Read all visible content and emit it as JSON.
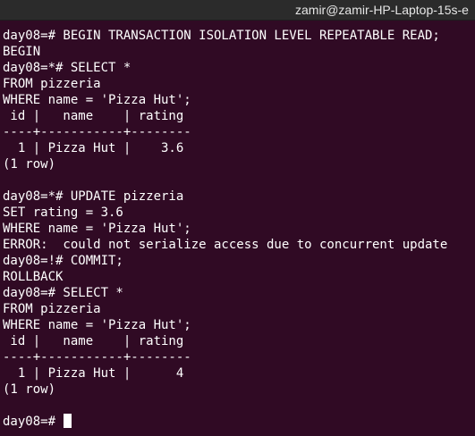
{
  "window": {
    "title": "zamir@zamir-HP-Laptop-15s-e"
  },
  "terminal": {
    "lines": [
      "day08=# BEGIN TRANSACTION ISOLATION LEVEL REPEATABLE READ;",
      "BEGIN",
      "day08=*# SELECT *",
      "FROM pizzeria",
      "WHERE name = 'Pizza Hut';",
      " id |   name    | rating",
      "----+-----------+--------",
      "  1 | Pizza Hut |    3.6",
      "(1 row)",
      "",
      "day08=*# UPDATE pizzeria",
      "SET rating = 3.6",
      "WHERE name = 'Pizza Hut';",
      "ERROR:  could not serialize access due to concurrent update",
      "day08=!# COMMIT;",
      "ROLLBACK",
      "day08=# SELECT *",
      "FROM pizzeria",
      "WHERE name = 'Pizza Hut';",
      " id |   name    | rating",
      "----+-----------+--------",
      "  1 | Pizza Hut |      4",
      "(1 row)",
      ""
    ],
    "prompt": "day08=# "
  },
  "colors": {
    "background": "#300a24",
    "text": "#ffffff",
    "titlebar": "#2b2b2b"
  }
}
